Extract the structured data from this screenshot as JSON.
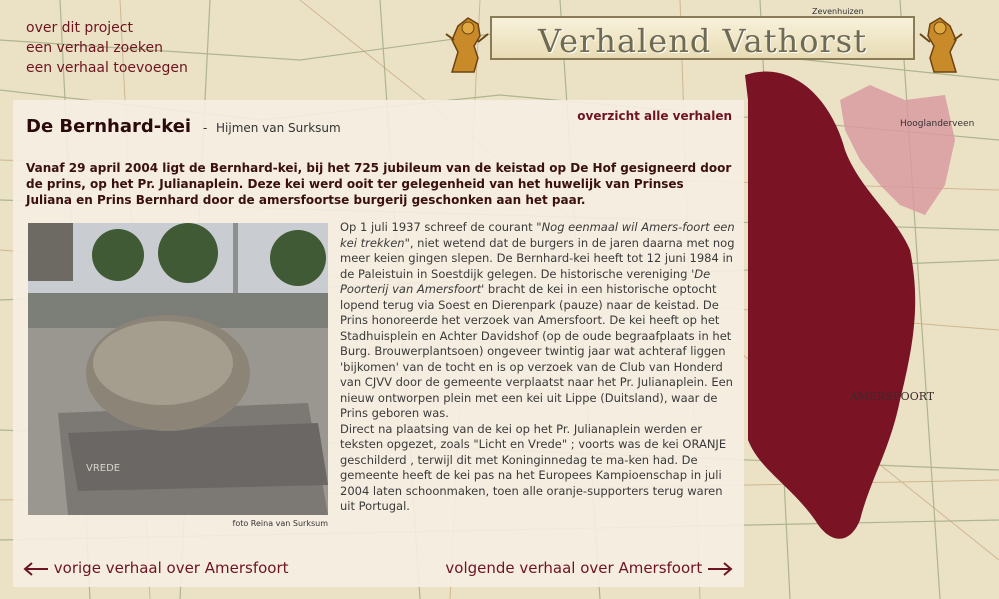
{
  "nav": {
    "about": "over dit project",
    "find": "een verhaal zoeken",
    "add": "een verhaal toevoegen"
  },
  "site": {
    "title": "Verhalend Vathorst"
  },
  "map_labels": {
    "zevenhuizen": "Zevenhuizen",
    "hooglanderveen": "Hooglanderveen",
    "amersfoort": "AMERSFOORT"
  },
  "story": {
    "title": "De Bernhard-kei",
    "separator": "-",
    "author": "Hijmen van Surksum",
    "overview_link": "overzicht alle verhalen",
    "intro": "Vanaf 29 april 2004 ligt de Bernhard-kei, bij het 725 jubileum van de keistad op De Hof gesigneerd door de prins, op het Pr. Julianaplein. Deze kei werd ooit ter gelegenheid van het huwelijk van Prinses Juliana en Prins Bernhard door de amersfoortse burgerij geschonken aan het paar.",
    "photo_alt": "VREDE",
    "photo_credit": "foto Reina van Surksum",
    "body": {
      "p1_a": "Op 1 juli 1937 schreef de courant ",
      "p1_quote": "\"Nog eenmaal wil Amers-foort een kei trekken\"",
      "p1_b": ", niet wetend dat de burgers in de jaren daarna met nog meer keien gingen slepen. De Bernhard-kei heeft tot 12 juni 1984 in de Paleistuin in Soestdijk gelegen. De historische vereniging ",
      "p1_assoc": "'De Poorterij van Amersfoort'",
      "p1_c": " bracht de kei in een historische optocht lopend terug via Soest en Dierenpark (pauze) naar de keistad. De Prins honoreerde het verzoek van Amersfoort. De kei heeft op het Stadhuisplein en Achter Davidshof (op de oude begraafplaats in het Burg. Brouwerplantsoen) ongeveer twintig jaar wat achteraf liggen 'bijkomen' van de tocht en is op verzoek van de Club van Honderd van CJVV door de gemeente verplaatst naar het Pr. Julianaplein. Een nieuw ontworpen plein met een kei uit Lippe (Duitsland), waar de Prins geboren was.",
      "p2": "Direct na plaatsing van de kei op het Pr. Julianaplein werden er teksten opgezet, zoals \"Licht en Vrede\" ; voorts was de kei ORANJE geschilderd , terwijl dit met Koninginnedag te ma-ken had. De gemeente heeft de kei pas na het Europees Kampioenschap in juli 2004 laten schoonmaken, toen alle oranje-supporters terug waren uit Portugal."
    },
    "prev": "vorige verhaal over Amersfoort",
    "next": "volgende verhaal over Amersfoort"
  },
  "colors": {
    "accent": "#6e1420",
    "region": "#7a1424",
    "region_light": "#d99aa0"
  },
  "icons": [
    "lion-icon",
    "arrow-left-icon",
    "arrow-right-icon"
  ]
}
